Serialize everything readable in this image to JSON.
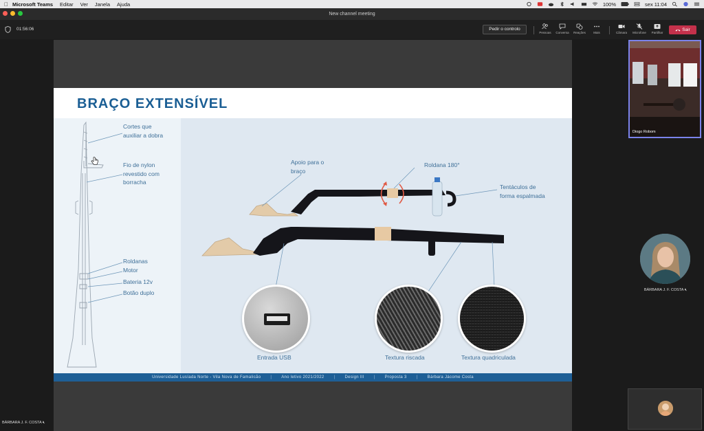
{
  "menubar": {
    "app_name": "Microsoft Teams",
    "items": [
      "Editar",
      "Ver",
      "Janela",
      "Ajuda"
    ],
    "battery": "100%",
    "clock": "sex 11:04"
  },
  "window": {
    "title": "New channel meeting"
  },
  "toolbar": {
    "timer": "01:56:06",
    "request_control": "Pedir o controlo",
    "people": "Pessoas",
    "chat": "Conversa",
    "reactions": "Reações",
    "more": "Mais",
    "camera": "Câmara",
    "microphone": "Microfone",
    "share": "Partilhar",
    "leave": "Sair"
  },
  "slide": {
    "title": "BRAÇO EXTENSÍVEL",
    "labels": {
      "cortes": "Cortes que\nauxiliar a dobra",
      "fio": "Fio de nylon\nrevestido com\nborracha",
      "roldanas": "Roldanas",
      "motor": "Motor",
      "bateria": "Bateria 12v",
      "botao": "Botão duplo",
      "apoio": "Apoio para o\nbraço",
      "roldana180": "Roldana 180°",
      "tentaculos": "Tentáculos de\nforma espalmada",
      "usb": "Entrada USB",
      "riscada": "Textura riscada",
      "quadriculada": "Textura quadriculada"
    },
    "footer": [
      "Universidade Lusíada Norte - Vila Nova de Famalicão",
      "Ano letivo 2021/2022",
      "Design III",
      "Proposta 3",
      "Bárbara Jácome Costa"
    ]
  },
  "participants": {
    "video_name": "Diogo Robom",
    "avatar_name": "BÁRBARA J. F. COSTA",
    "presenter_name": "BÁRBARA J. F. COSTA"
  },
  "colors": {
    "accent": "#1a5e94",
    "leave": "#c4314b",
    "teams_purple": "#7b83eb"
  }
}
